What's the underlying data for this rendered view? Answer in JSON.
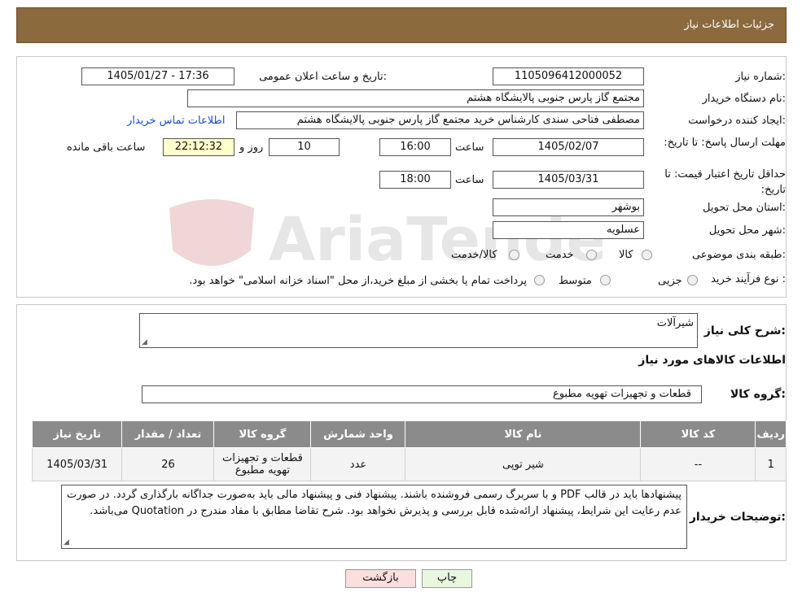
{
  "header": {
    "title": "جزئیات اطلاعات نیاز"
  },
  "info": {
    "need_number_label": "شماره نیاز:",
    "need_number": "1105096412000052",
    "announce_label": "تاریخ و ساعت اعلان عمومی:",
    "announce_value": "1405/01/27 - 17:36",
    "buyer_label": "نام دستگاه خریدار:",
    "buyer_value": "مجتمع گاز پارس جنوبی  پالایشگاه هشتم",
    "creator_label": "ایجاد کننده درخواست:",
    "creator_value": "مصطفی فتاحی سندی کارشناس خرید مجتمع گاز پارس جنوبی  پالایشگاه هشتم",
    "contact_link": "اطلاعات تماس خریدار",
    "deadline_label": "مهلت ارسال پاسخ: تا تاریخ:",
    "deadline_date": "1405/02/07",
    "time_label": "ساعت",
    "deadline_time": "16:00",
    "days_value": "10",
    "days_label": "روز و",
    "remaining_value": "22:12:32",
    "remaining_label": "ساعت باقی مانده",
    "validity_label": "حداقل تاریخ اعتبار قیمت: تا تاریخ:",
    "validity_date": "1405/03/31",
    "validity_time": "18:00",
    "province_label": "استان محل تحویل:",
    "province_value": "بوشهر",
    "city_label": "شهر محل تحویل:",
    "city_value": "عسلویه",
    "category_label": "طبقه بندی موضوعی:",
    "category_options": [
      "کالا",
      "خدمت",
      "کالا/خدمت"
    ],
    "process_label": "نوع فرآیند خرید :",
    "process_options": [
      "جزیی",
      "متوسط"
    ],
    "process_note": "پرداخت تمام یا بخشی از مبلغ خرید،از محل \"اسناد خزانه اسلامی\" خواهد بود."
  },
  "detail": {
    "summary_label": "شرح کلی نیاز:",
    "summary_value": "شیرآلات",
    "goods_title": "اطلاعات کالاهای مورد نیاز",
    "group_label": "گروه کالا:",
    "group_value": "قطعات و تجهیزات تهویه مطبوع",
    "table": {
      "headers": [
        "ردیف",
        "کد کالا",
        "نام کالا",
        "واحد شمارش",
        "گروه کالا",
        "تعداد / مقدار",
        "تاریخ نیاز"
      ],
      "rows": [
        [
          "1",
          "--",
          "شیر توپی",
          "عدد",
          "قطعات و تجهیزات تهویه مطبوع",
          "26",
          "1405/03/31"
        ]
      ]
    },
    "buyer_notes_label": "توضیحات خریدار:",
    "buyer_notes_value": "پیشنهادها باید در قالب PDF و با سربرگ رسمی فروشنده باشند. پیشنهاد فنی و پیشنهاد مالی باید به‌صورت جداگانه بارگذاری گردد. در صورت عدم رعایت این شرایط، پیشنهاد ارائه‌شده قابل بررسی و پذیرش نخواهد بود. شرح تقاضا مطابق با مفاد مندرج در Quotation می‌باشد."
  },
  "buttons": {
    "print": "چاپ",
    "back": "بازگشت"
  },
  "watermark": {
    "text": "AriaTender.neT"
  },
  "colors": {
    "header_bg": "#8b6a3e",
    "table_header_bg": "#8b8b8b",
    "link": "#1a4fcf",
    "print_btn": "#e9f7df",
    "back_btn": "#fbdede"
  }
}
